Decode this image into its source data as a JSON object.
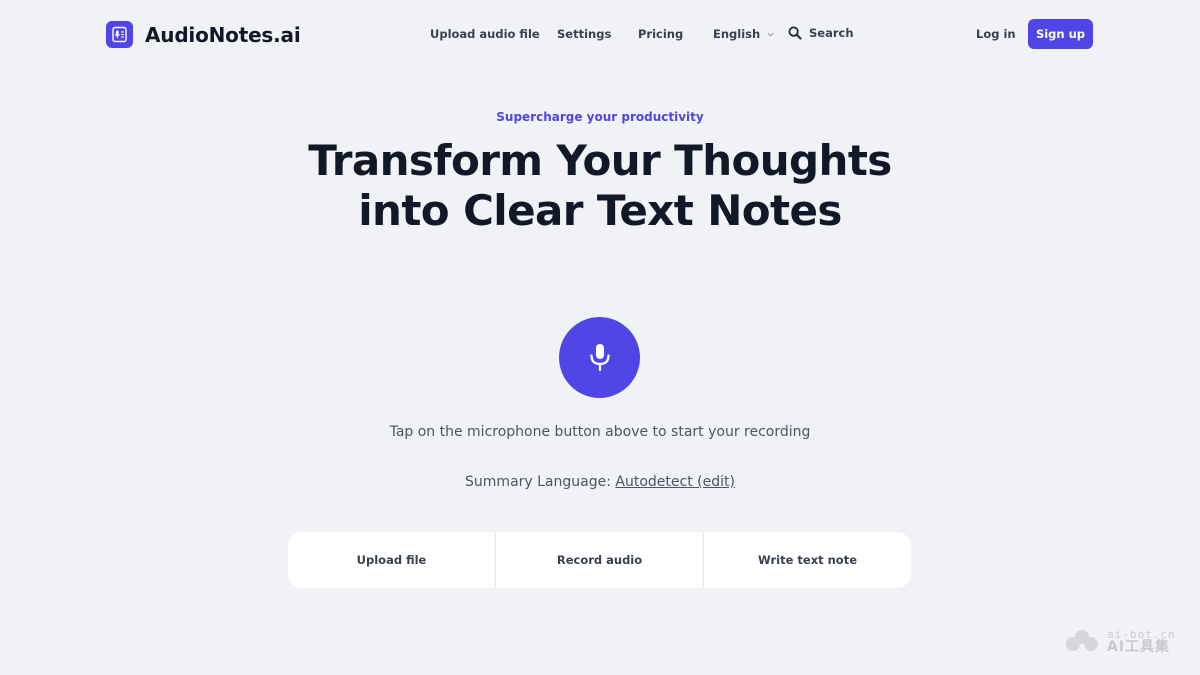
{
  "header": {
    "brand": "AudioNotes.ai",
    "nav": {
      "upload": "Upload audio file",
      "settings": "Settings",
      "pricing": "Pricing",
      "language": "English",
      "search": "Search"
    },
    "login": "Log in",
    "signup": "Sign up"
  },
  "hero": {
    "eyebrow": "Supercharge your productivity",
    "title": "Transform Your Thoughts into Clear Text Notes",
    "hint": "Tap on the microphone button above to start your recording",
    "summary_label": "Summary Language:",
    "summary_value": "Autodetect (edit)"
  },
  "tabs": {
    "upload": "Upload file",
    "record": "Record audio",
    "write": "Write text note"
  },
  "watermark": {
    "line1": "ai-bot.cn",
    "line2": "AI工具集"
  },
  "colors": {
    "accent": "#4f46e5",
    "background": "#f1f2f5"
  },
  "icons": [
    "logo-document-mic-icon",
    "chevron-down-icon",
    "search-icon",
    "microphone-icon"
  ]
}
